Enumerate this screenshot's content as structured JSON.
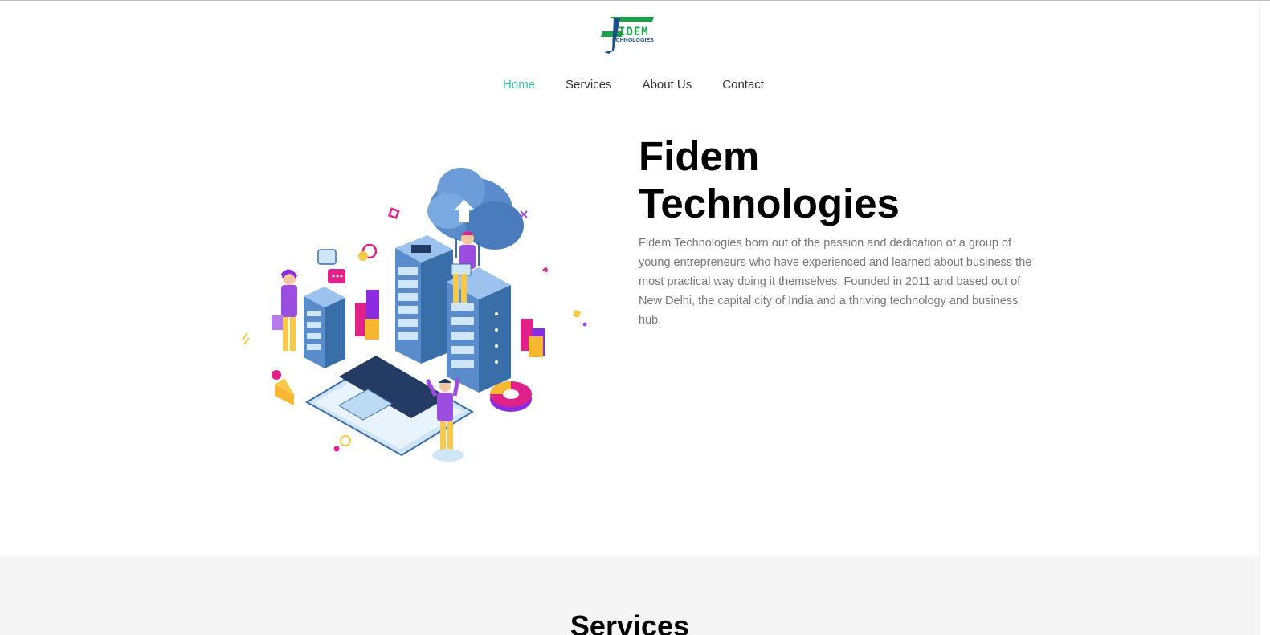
{
  "brand": {
    "logo_main": "IDEM",
    "logo_sub": "ECHNOLOGIES",
    "green": "#1aa24a",
    "blue": "#1b4f86"
  },
  "nav": {
    "items": [
      {
        "label": "Home",
        "active": true
      },
      {
        "label": "Services",
        "active": false
      },
      {
        "label": "About Us",
        "active": false
      },
      {
        "label": "Contact",
        "active": false
      }
    ],
    "active_color": "#3cc4a2"
  },
  "hero": {
    "title_line1": "Fidem",
    "title_line2": "Technologies",
    "description": "Fidem Technologies born out of the passion and dedication of a group of young entrepreneurs who have experienced and learned about business the most practical way doing it themselves. Founded in 2011 and based out of New Delhi, the capital city of India and a thriving technology and business hub.",
    "illustration": "isometric-cloud-server-illustration"
  },
  "services": {
    "heading": "Services"
  }
}
